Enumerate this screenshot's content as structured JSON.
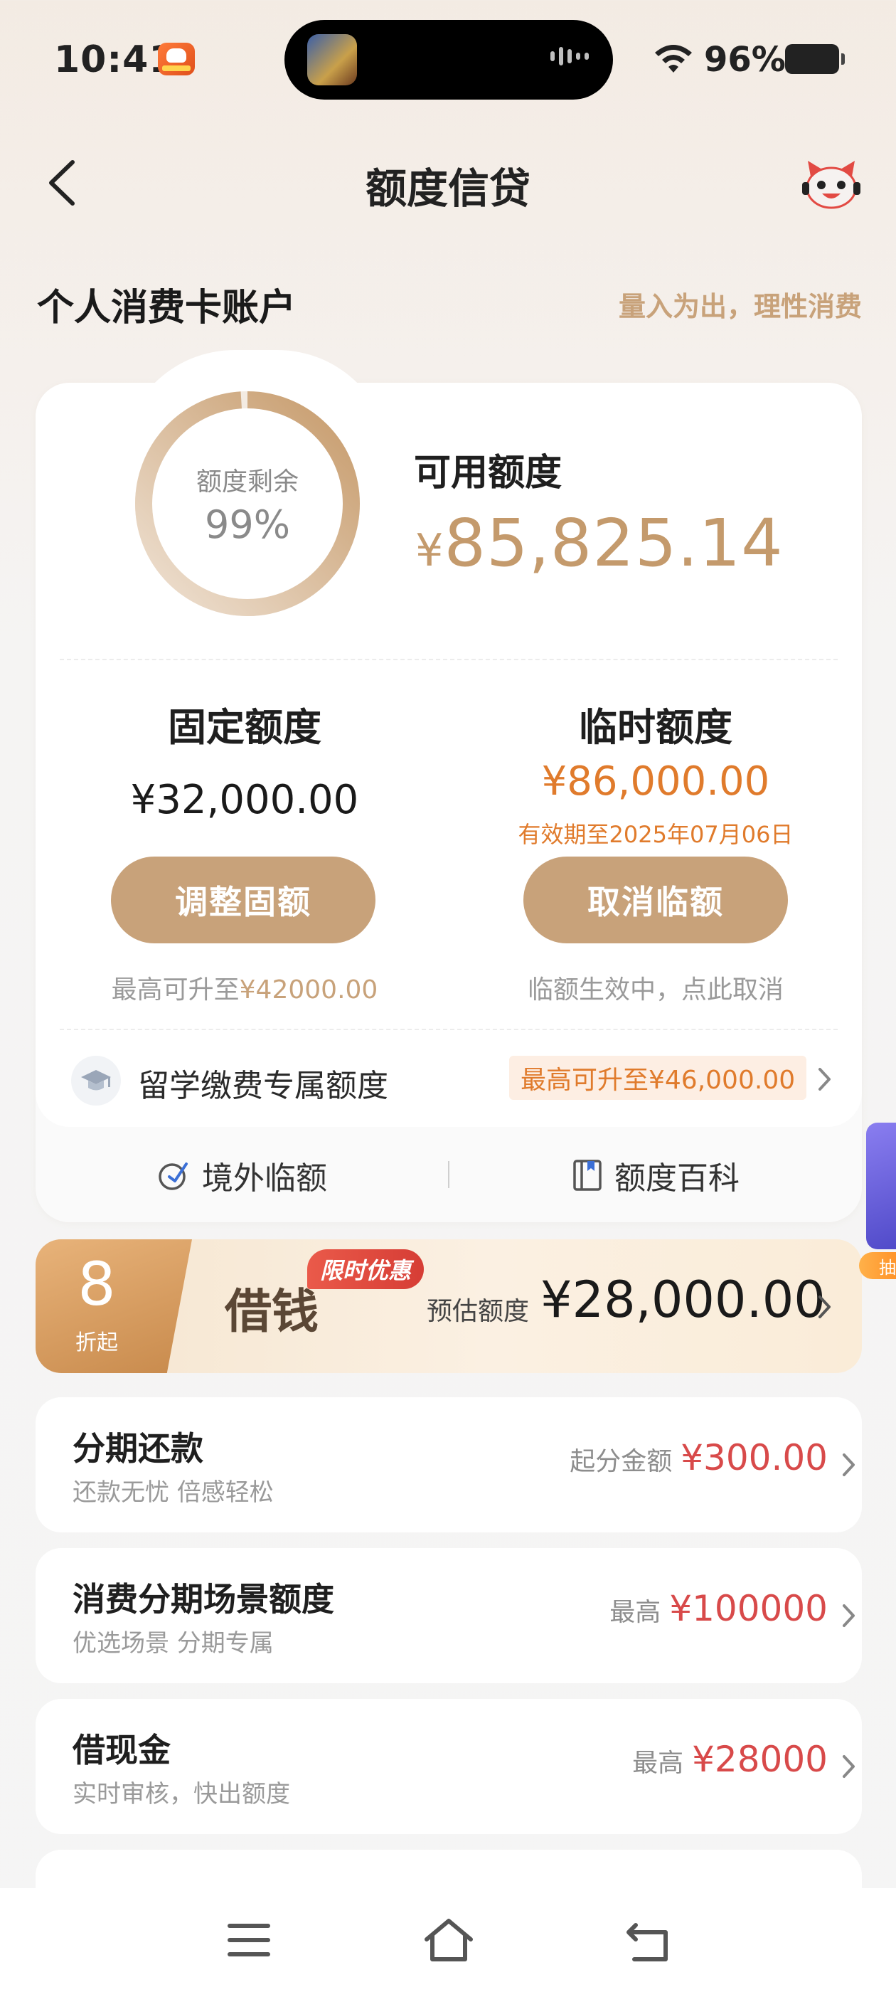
{
  "status_bar": {
    "time": "10:41",
    "battery": "96%"
  },
  "header": {
    "title": "额度信贷"
  },
  "account": {
    "title": "个人消费卡账户",
    "slogan": "量入为出，理性消费"
  },
  "summary": {
    "ring_label": "额度剩余",
    "ring_percent": "99%",
    "ring_fill": 0.99,
    "available_label": "可用额度",
    "available_symbol": "¥",
    "available_value": "85,825.14"
  },
  "fixed": {
    "title": "固定额度",
    "amount": "¥32,000.00",
    "button": "调整固额",
    "hint_prefix": "最高可升至",
    "hint_value": "¥42000.00"
  },
  "temporary": {
    "title": "临时额度",
    "amount": "¥86,000.00",
    "expiry": "有效期至2025年07月06日",
    "button": "取消临额",
    "hint": "临额生效中，点此取消"
  },
  "study": {
    "label": "留学缴费专属额度",
    "tag": "最高可升至¥46,000.00"
  },
  "footer_links": {
    "overseas": "境外临额",
    "wiki": "额度百科"
  },
  "promo": {
    "discount": "8",
    "discount_sub": "折起",
    "badge": "限时优惠",
    "title": "借钱",
    "est_label": "预估额度",
    "est_value": "¥28,000.00"
  },
  "list": [
    {
      "title": "分期还款",
      "subtitle": "还款无忧 倍感轻松",
      "label": "起分金额",
      "value": "¥300.00"
    },
    {
      "title": "消费分期场景额度",
      "subtitle": "优选场景 分期专属",
      "label": "最高",
      "value": "¥100000"
    },
    {
      "title": "借现金",
      "subtitle": "实时审核，快出额度",
      "label": "最高",
      "value": "¥28000"
    }
  ],
  "side_tag": "抽",
  "colors": {
    "gold": "#c8a27a",
    "orange": "#e07b2c",
    "red": "#d84a4a"
  }
}
